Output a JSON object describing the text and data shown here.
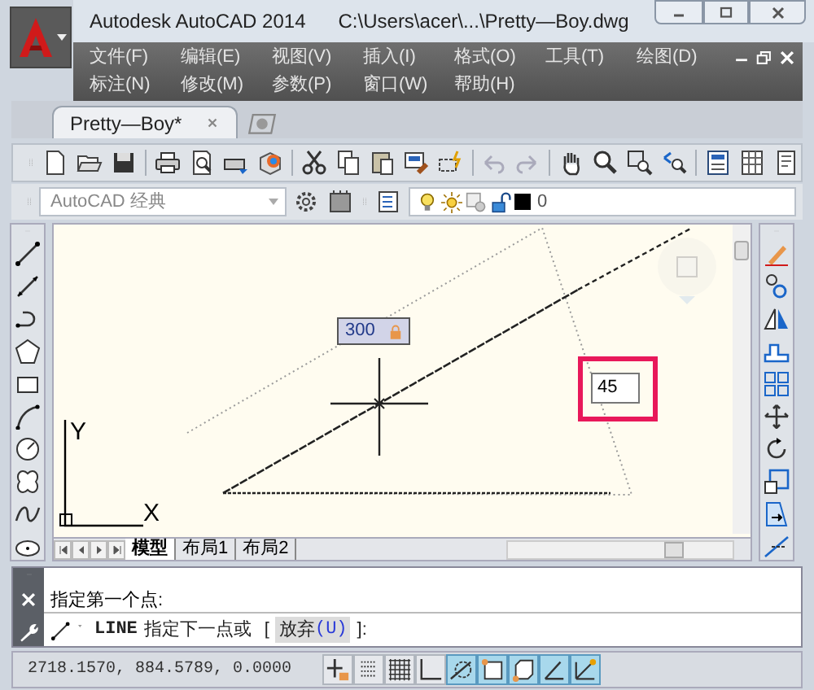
{
  "window": {
    "title": "Autodesk AutoCAD 2014",
    "file_path": "C:\\Users\\acer\\...\\Pretty—Boy.dwg"
  },
  "menu": [
    [
      "文件(F)",
      "编辑(E)",
      "视图(V)",
      "插入(I)",
      "格式(O)",
      "工具(T)",
      "绘图(D)"
    ],
    [
      "标注(N)",
      "修改(M)",
      "参数(P)",
      "窗口(W)",
      "帮助(H)"
    ]
  ],
  "document_tabs": [
    {
      "label": "Pretty—Boy*",
      "selected": true
    }
  ],
  "workspace": {
    "value": "AutoCAD 经典"
  },
  "layer": {
    "value": "0"
  },
  "canvas": {
    "distance_input": "300",
    "angle_input": "45",
    "axis_y": "Y",
    "axis_x": "X"
  },
  "layout_tabs": [
    {
      "label": "模型",
      "selected": true
    },
    {
      "label": "布局1",
      "selected": false
    },
    {
      "label": "布局2",
      "selected": false
    }
  ],
  "command_history": [
    "指定第一个点:"
  ],
  "command_line": {
    "command": "LINE",
    "prompt": "指定下一点或",
    "bracket_open": "[",
    "option": "放弃",
    "option_key": "(U)",
    "bracket_close": "]:"
  },
  "status_bar": {
    "coordinates": "2718.1570, 884.5789, 0.0000",
    "toggles": [
      {
        "kind": "infer",
        "on": false
      },
      {
        "kind": "snap",
        "on": false
      },
      {
        "kind": "grid",
        "on": false
      },
      {
        "kind": "ortho",
        "on": false
      },
      {
        "kind": "polar",
        "on": true
      },
      {
        "kind": "osnap",
        "on": true
      },
      {
        "kind": "osnap3d",
        "on": true
      },
      {
        "kind": "otrack",
        "on": true
      },
      {
        "kind": "ducs",
        "on": true
      }
    ]
  }
}
